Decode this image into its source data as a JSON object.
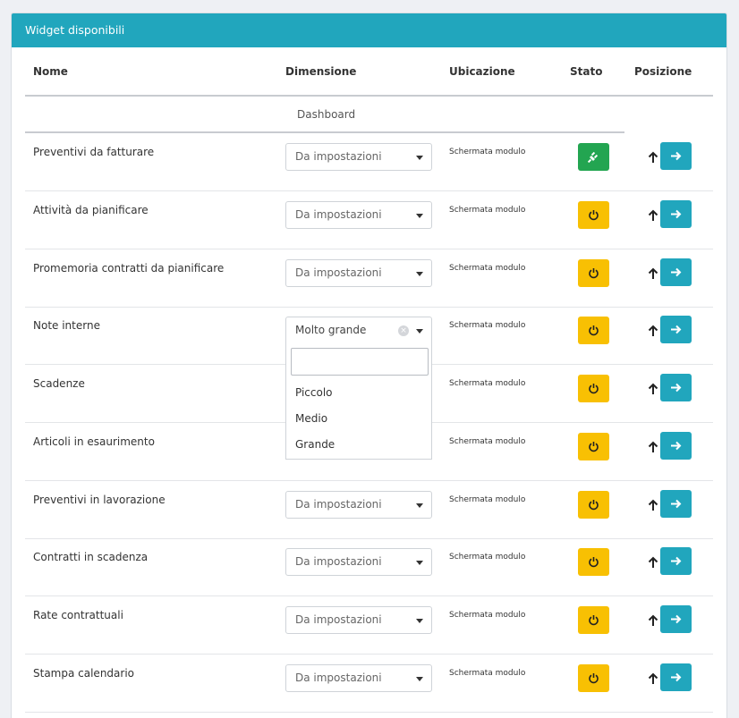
{
  "panel": {
    "title": "Widget disponibili"
  },
  "table": {
    "headers": {
      "name": "Nome",
      "size": "Dimensione",
      "location": "Ubicazione",
      "state": "Stato",
      "position": "Posizione"
    },
    "group": "Dashboard",
    "rows": [
      {
        "name": "Preventivi da fatturare",
        "size": "Da impostazioni",
        "location": "Schermata modulo",
        "state": "active"
      },
      {
        "name": "Attività da pianificare",
        "size": "Da impostazioni",
        "location": "Schermata modulo",
        "state": "inactive"
      },
      {
        "name": "Promemoria contratti da pianificare",
        "size": "Da impostazioni",
        "location": "Schermata modulo",
        "state": "inactive"
      },
      {
        "name": "Note interne",
        "size": "Molto grande",
        "location": "Schermata modulo",
        "state": "inactive"
      },
      {
        "name": "Scadenze",
        "size": "",
        "location": "Schermata modulo",
        "state": "inactive"
      },
      {
        "name": "Articoli in esaurimento",
        "size": "",
        "location": "Schermata modulo",
        "state": "inactive"
      },
      {
        "name": "Preventivi in lavorazione",
        "size": "Da impostazioni",
        "location": "Schermata modulo",
        "state": "inactive"
      },
      {
        "name": "Contratti in scadenza",
        "size": "Da impostazioni",
        "location": "Schermata modulo",
        "state": "inactive"
      },
      {
        "name": "Rate contrattuali",
        "size": "Da impostazioni",
        "location": "Schermata modulo",
        "state": "inactive"
      },
      {
        "name": "Stampa calendario",
        "size": "Da impostazioni",
        "location": "Schermata modulo",
        "state": "inactive"
      }
    ]
  },
  "dropdown": {
    "search_value": "",
    "options": [
      "Piccolo",
      "Medio",
      "Grande"
    ]
  },
  "colors": {
    "header": "#21a6bd",
    "active": "#23a551",
    "inactive": "#f8c003",
    "move": "#21a6bd"
  },
  "icons": {
    "active_state": "plug-icon",
    "inactive_state": "power-icon",
    "move_up": "arrow-up-icon",
    "move_right": "arrow-right-icon",
    "clear": "clear-icon",
    "caret": "chevron-down-icon"
  }
}
